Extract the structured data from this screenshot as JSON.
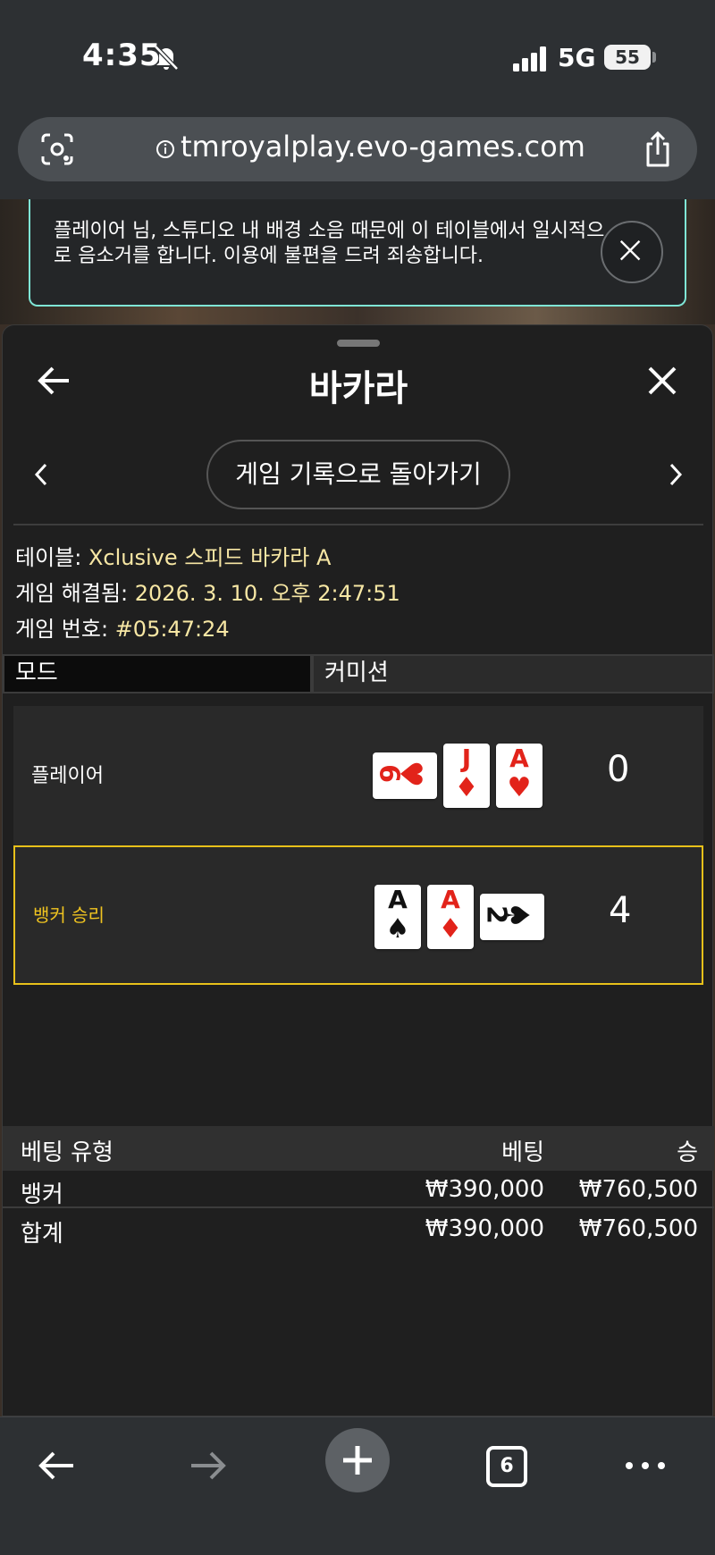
{
  "status_bar": {
    "time": "4:35",
    "network": "5G",
    "battery": "55"
  },
  "browser": {
    "url": "tmroyalplay.evo-games.com",
    "tab_count": "6"
  },
  "notice": {
    "text": "플레이어 님, 스튜디오 내 배경 소음 때문에 이 테이블에서 일시적으로 음소거를 합니다. 이용에 불편을 드려 죄송합니다."
  },
  "sheet": {
    "title": "바카라",
    "history_button": "게임 기록으로 돌아가기",
    "table_label": "테이블:",
    "table_value": "Xclusive 스피드 바카라 A",
    "resolved_label": "게임 해결됨:",
    "resolved_value": "2026. 3. 10. 오후 2:47:51",
    "game_no_label": "게임 번호:",
    "game_no_value": "#05:47:24",
    "tabs": {
      "mode": "모드",
      "commission": "커미션"
    }
  },
  "hands": {
    "player": {
      "label": "플레이어",
      "score": "0",
      "cards": [
        {
          "rank": "6",
          "suit": "♥",
          "color": "#e2231a",
          "sideways": true
        },
        {
          "rank": "J",
          "suit": "♦",
          "color": "#e2231a",
          "sideways": false
        },
        {
          "rank": "A",
          "suit": "♥",
          "color": "#e2231a",
          "sideways": false
        }
      ]
    },
    "banker": {
      "label": "뱅커 승리",
      "score": "4",
      "cards": [
        {
          "rank": "A",
          "suit": "♠",
          "color": "#111111",
          "sideways": false
        },
        {
          "rank": "A",
          "suit": "♦",
          "color": "#e2231a",
          "sideways": false
        },
        {
          "rank": "2",
          "suit": "♠",
          "color": "#111111",
          "sideways": true
        }
      ]
    }
  },
  "bets": {
    "headers": {
      "type": "베팅 유형",
      "bet": "베팅",
      "win": "승"
    },
    "rows": [
      {
        "type": "뱅커",
        "bet": "₩390,000",
        "win": "₩760,500"
      }
    ],
    "total": {
      "type": "합계",
      "bet": "₩390,000",
      "win": "₩760,500"
    }
  },
  "colors": {
    "accent_gold": "#e8c11a",
    "info_value": "#f7e7a4",
    "notice_border": "#7fe6d6"
  }
}
